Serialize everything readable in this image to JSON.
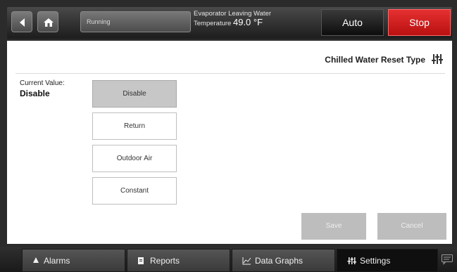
{
  "header": {
    "status": "Running",
    "evap_line1": "Evaporator Leaving Water",
    "evap_prefix": "Temperature",
    "evap_value": "49.0 °F",
    "auto_label": "Auto",
    "stop_label": "Stop"
  },
  "panel": {
    "title": "Chilled Water Reset Type",
    "current_value_label": "Current Value:",
    "current_value": "Disable",
    "options": [
      "Disable",
      "Return",
      "Outdoor Air",
      "Constant"
    ],
    "selected_option": "Disable",
    "save_label": "Save",
    "cancel_label": "Cancel"
  },
  "tabs": [
    {
      "label": "Alarms",
      "icon": "alarm-triangle-icon"
    },
    {
      "label": "Reports",
      "icon": "report-icon"
    },
    {
      "label": "Data Graphs",
      "icon": "graph-icon"
    },
    {
      "label": "Settings",
      "icon": "settings-sliders-icon"
    }
  ],
  "colors": {
    "stop": "#d42020",
    "selected_option": "#c7c7c7",
    "disabled_button": "#bdbdbd"
  }
}
